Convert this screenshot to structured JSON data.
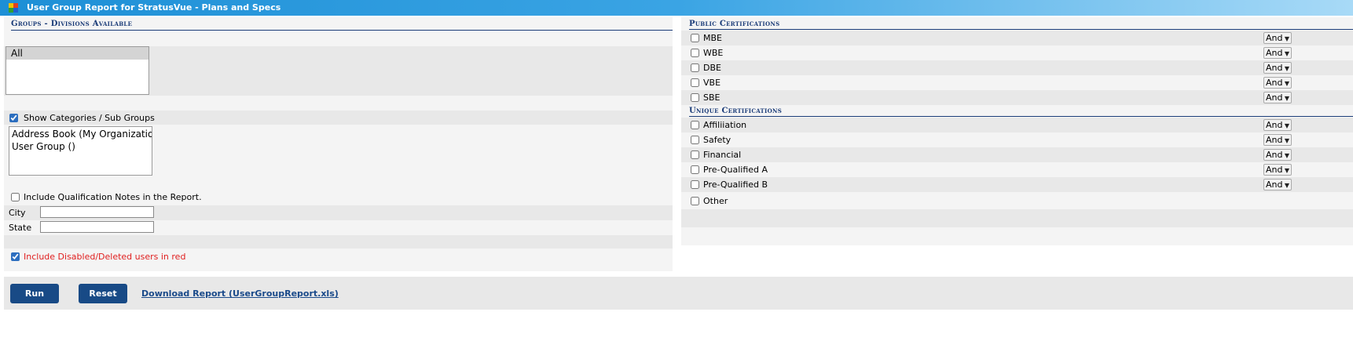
{
  "window": {
    "title": "User Group Report for StratusVue - Plans and Specs",
    "accent": "#1d8fd6"
  },
  "groups": {
    "heading": "Groups - Divisions Available",
    "list": [
      "All"
    ],
    "selected": "All"
  },
  "categories": {
    "show_label": "Show Categories / Sub Groups",
    "show_checked": true,
    "list": [
      "Address Book (My Organization Ac",
      "User Group ()"
    ]
  },
  "qualification": {
    "label": "Include Qualification Notes in the Report.",
    "checked": false
  },
  "filters": {
    "city_label": "City",
    "city_value": "",
    "state_label": "State",
    "state_value": ""
  },
  "disabled_users": {
    "label": "Include Disabled/Deleted users in red",
    "checked": true,
    "color": "#e02020"
  },
  "public_certs": {
    "heading": "Public Certifications",
    "items": [
      {
        "label": "MBE",
        "op": "And"
      },
      {
        "label": "WBE",
        "op": "And"
      },
      {
        "label": "DBE",
        "op": "And"
      },
      {
        "label": "VBE",
        "op": "And"
      },
      {
        "label": "SBE",
        "op": "And"
      }
    ]
  },
  "unique_certs": {
    "heading": "Unique Certifications",
    "items": [
      {
        "label": "Affiliiation",
        "op": "And"
      },
      {
        "label": "Safety",
        "op": "And"
      },
      {
        "label": "Financial",
        "op": "And"
      },
      {
        "label": "Pre-Qualified A",
        "op": "And"
      },
      {
        "label": "Pre-Qualified B",
        "op": "And"
      }
    ],
    "other_label": "Other"
  },
  "actions": {
    "run": "Run",
    "reset": "Reset",
    "download": "Download Report (UserGroupReport.xls)"
  }
}
